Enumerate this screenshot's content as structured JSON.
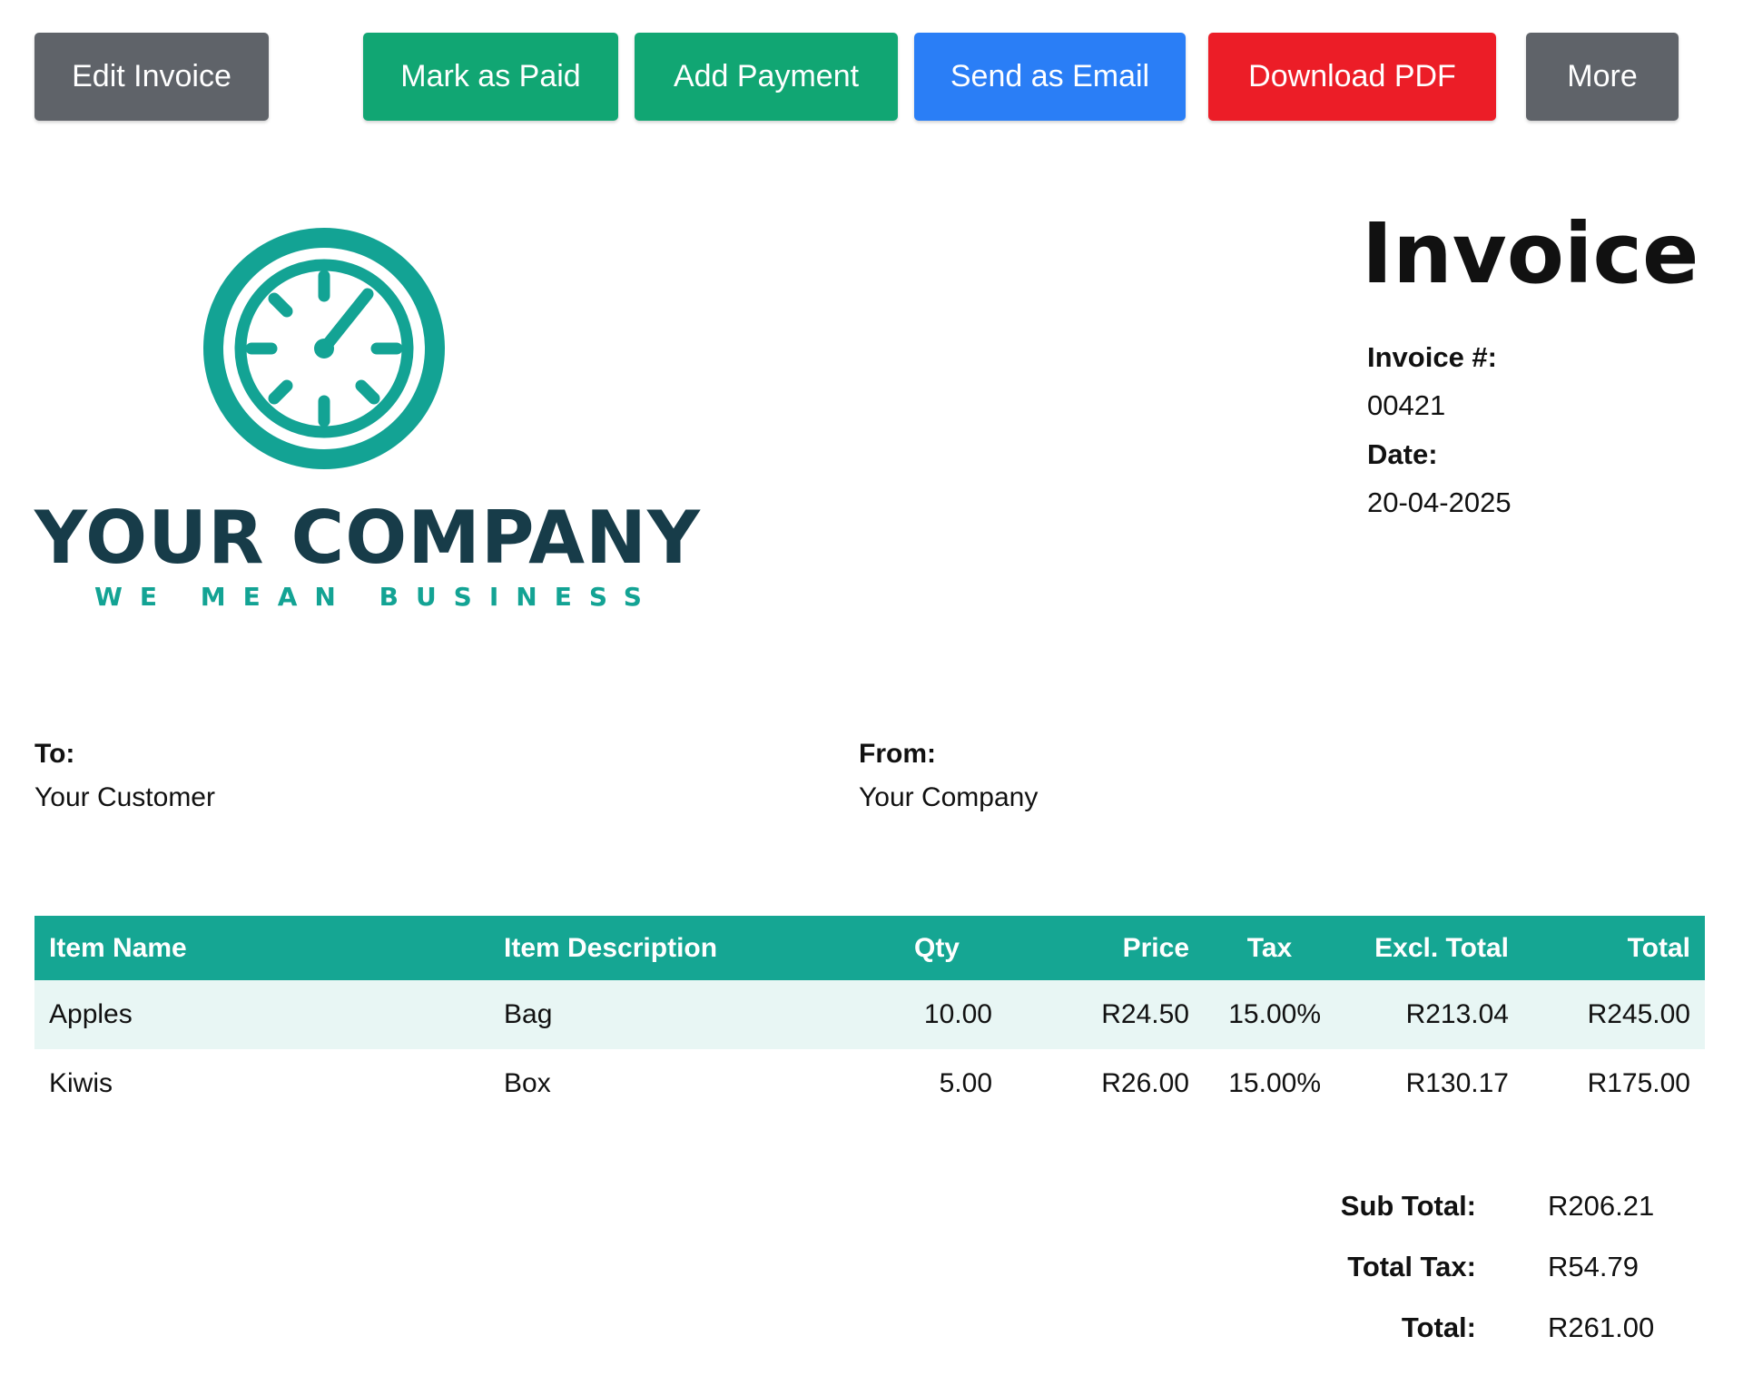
{
  "toolbar": {
    "edit_label": "Edit Invoice",
    "mark_paid_label": "Mark as Paid",
    "add_payment_label": "Add Payment",
    "send_email_label": "Send as Email",
    "download_pdf_label": "Download PDF",
    "more_label": "More"
  },
  "logo": {
    "icon": "clock-icon",
    "name": "YOUR COMPANY",
    "tagline": "WE MEAN BUSINESS",
    "icon_color": "#13a394",
    "name_color": "#173c49"
  },
  "invoice": {
    "title": "Invoice",
    "number_label": "Invoice #:",
    "number": "00421",
    "date_label": "Date:",
    "date": "20-04-2025"
  },
  "parties": {
    "to_label": "To:",
    "to_name": "Your Customer",
    "from_label": "From:",
    "from_name": "Your Company"
  },
  "items_table": {
    "headers": [
      "Item Name",
      "Item Description",
      "Qty",
      "Price",
      "Tax",
      "Excl. Total",
      "Total"
    ],
    "rows": [
      [
        "Apples",
        "Bag",
        "10.00",
        "R24.50",
        "15.00%",
        "R213.04",
        "R245.00"
      ],
      [
        "Kiwis",
        "Box",
        "5.00",
        "R26.00",
        "15.00%",
        "R130.17",
        "R175.00"
      ]
    ]
  },
  "totals": {
    "subtotal_label": "Sub Total:",
    "subtotal": "R206.21",
    "tax_label": "Total Tax:",
    "tax": "R54.79",
    "total_label": "Total:",
    "total": "R261.00"
  },
  "colors": {
    "grey_button": "#5f6369",
    "green_button": "#11a673",
    "blue_button": "#2a7ef6",
    "red_button": "#ec1d27",
    "table_header": "#15a693",
    "row_highlight": "#e8f6f4"
  }
}
